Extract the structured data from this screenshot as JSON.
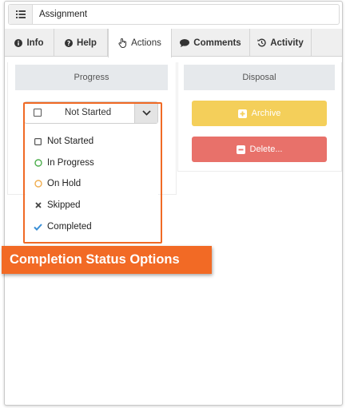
{
  "title_bar": {
    "title": "Assignment",
    "menu_icon": "list-icon"
  },
  "tabs": [
    {
      "label": "Info",
      "icon": "info-circle-icon",
      "active": false
    },
    {
      "label": "Help",
      "icon": "question-circle-icon",
      "active": false
    },
    {
      "label": "Actions",
      "icon": "hand-pointer-icon",
      "active": true
    },
    {
      "label": "Comments",
      "icon": "comment-icon",
      "active": false
    },
    {
      "label": "Activity",
      "icon": "history-icon",
      "active": false
    }
  ],
  "progress": {
    "heading": "Progress",
    "selected_value": "Not Started",
    "options": [
      {
        "label": "Not Started",
        "icon": "square-icon",
        "color": "#555555"
      },
      {
        "label": "In Progress",
        "icon": "circle-icon",
        "color": "#4cae4c"
      },
      {
        "label": "On Hold",
        "icon": "circle-icon",
        "color": "#f0ad4e"
      },
      {
        "label": "Skipped",
        "icon": "times-icon",
        "color": "#444444"
      },
      {
        "label": "Completed",
        "icon": "check-icon",
        "color": "#3a8fd6"
      }
    ]
  },
  "disposal": {
    "heading": "Disposal",
    "archive_label": "Archive",
    "delete_label": "Delete...",
    "archive_color": "#f4cf5a",
    "delete_color": "#e8716a"
  },
  "callout": {
    "label": "Completion Status Options",
    "color": "#f26a25"
  }
}
